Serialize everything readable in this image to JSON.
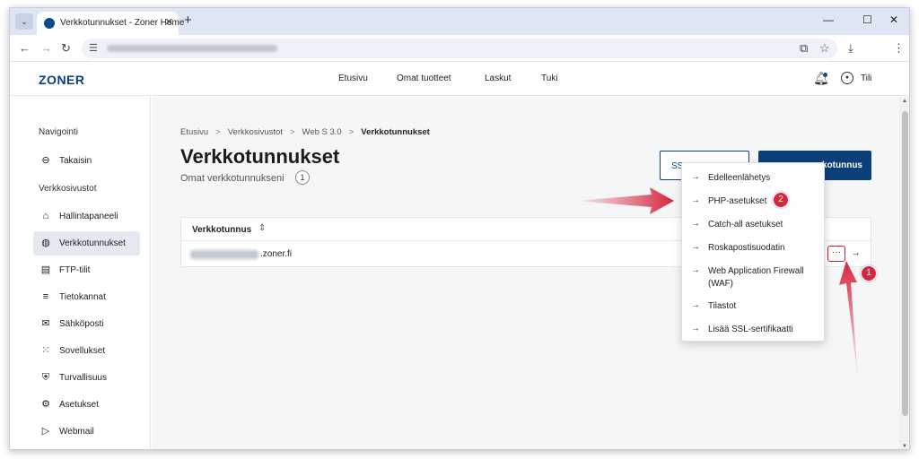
{
  "browser": {
    "tab_title": "Verkkotunnukset - Zoner Home",
    "tab_close": "✕",
    "new_tab": "+",
    "tab_list": "⌄",
    "window_controls": {
      "minimize": "—",
      "maximize": "☐",
      "close": "✕"
    }
  },
  "site": {
    "logo": "ZONER",
    "nav": [
      "Etusivu",
      "Omat tuotteet",
      "Laskut",
      "Tuki"
    ],
    "account_label": "Tili"
  },
  "sidebar": {
    "nav_heading": "Navigointi",
    "back_label": "Takaisin",
    "section_heading": "Verkkosivustot",
    "items": [
      {
        "label": "Hallintapaneeli",
        "icon": "home-icon",
        "active": false
      },
      {
        "label": "Verkkotunnukset",
        "icon": "globe-icon",
        "active": true
      },
      {
        "label": "FTP-tilit",
        "icon": "server-icon",
        "active": false
      },
      {
        "label": "Tietokannat",
        "icon": "database-icon",
        "active": false
      },
      {
        "label": "Sähköposti",
        "icon": "mail-icon",
        "active": false
      },
      {
        "label": "Sovellukset",
        "icon": "apps-icon",
        "active": false
      },
      {
        "label": "Turvallisuus",
        "icon": "shield-icon",
        "active": false
      },
      {
        "label": "Asetukset",
        "icon": "gear-icon",
        "active": false
      },
      {
        "label": "Webmail",
        "icon": "send-icon",
        "active": false
      }
    ]
  },
  "breadcrumb": {
    "items": [
      "Etusivu",
      "Verkkosivustot",
      "Web S 3.0"
    ],
    "current": "Verkkotunnukset",
    "separator": ">"
  },
  "page": {
    "title": "Verkkotunnukset",
    "subtitle": "Omat verkkotunnukseni",
    "count": "1",
    "ssl_button_label": "SS",
    "primary_button_label": "kotunnus"
  },
  "table": {
    "column_header": "Verkkotunnus",
    "rows": [
      {
        "domain_suffix": ".zoner.fi"
      }
    ],
    "more_label": "···",
    "row_arrow": "→"
  },
  "dropdown": {
    "items": [
      "Edelleenlähetys",
      "PHP-asetukset",
      "Catch-all asetukset",
      "Roskapostisuodatin",
      "Web Application Firewall (WAF)",
      "Tilastot",
      "Lisää SSL-sertifikaatti"
    ],
    "arrow": "→"
  },
  "annotations": {
    "step1": "1",
    "step2": "2",
    "color": "#d7263d"
  },
  "colors": {
    "brand": "#0b3f7a",
    "active_bg": "#e4e9f1",
    "tabstrip": "#dfe6f3"
  }
}
